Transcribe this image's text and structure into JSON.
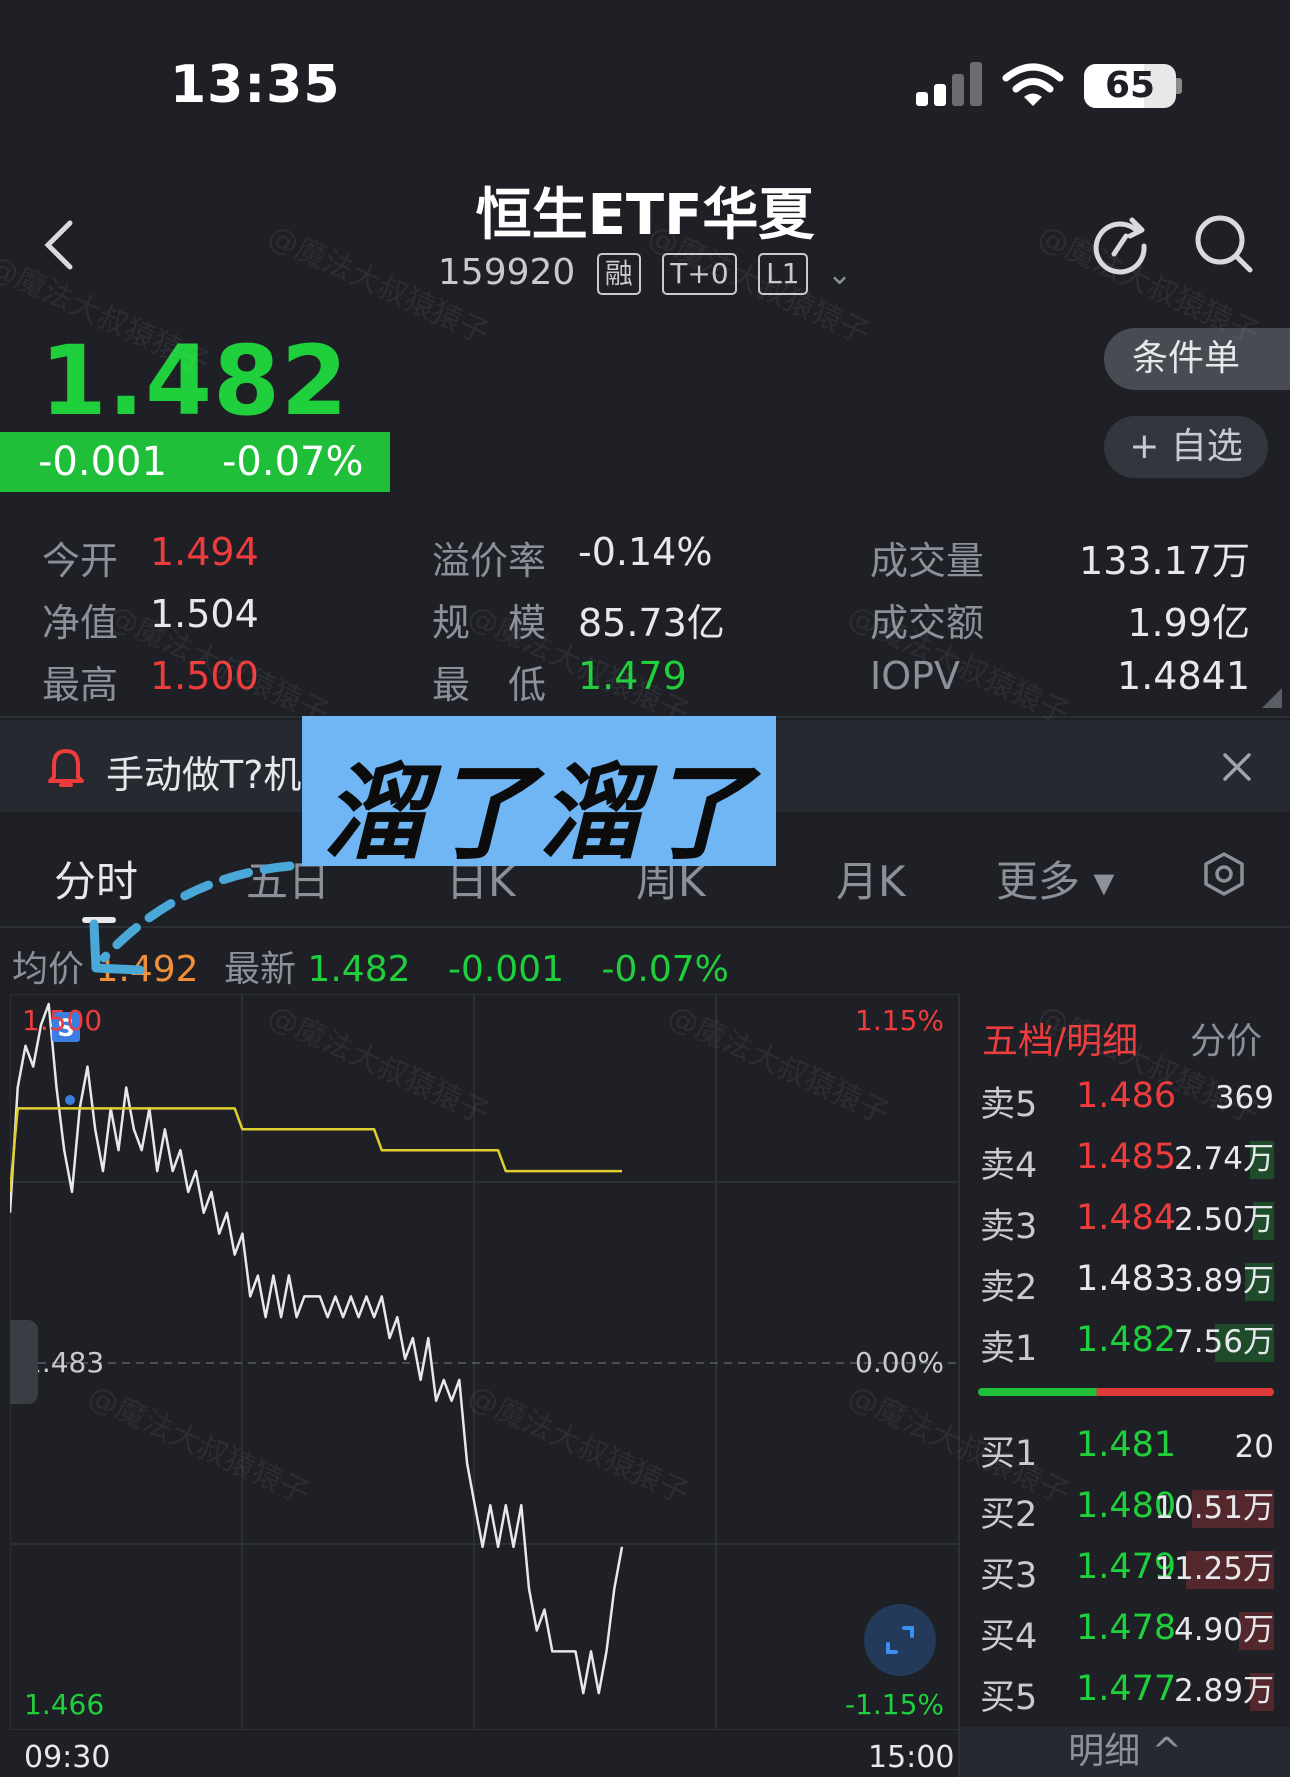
{
  "status_bar": {
    "time": "13:35",
    "battery": "65"
  },
  "header": {
    "title": "恒生ETF华夏",
    "code": "159920",
    "tags": [
      "融",
      "T+0",
      "L1"
    ]
  },
  "quote": {
    "price": "1.482",
    "change": "-0.001",
    "change_pct": "-0.07%",
    "buttons": {
      "condition_order": "条件单",
      "add_watch": "+ 自选"
    }
  },
  "stats": [
    {
      "label": "今开",
      "value": "1.494",
      "color": "red"
    },
    {
      "label": "溢价率",
      "value": "-0.14%",
      "color": "white"
    },
    {
      "label": "成交量",
      "value": "133.17万",
      "color": "white"
    },
    {
      "label": "净值",
      "value": "1.504",
      "color": "white"
    },
    {
      "label": "规　模",
      "value": "85.73亿",
      "color": "white"
    },
    {
      "label": "成交额",
      "value": "1.99亿",
      "color": "white"
    },
    {
      "label": "最高",
      "value": "1.500",
      "color": "red"
    },
    {
      "label": "最　低",
      "value": "1.479",
      "color": "green"
    },
    {
      "label": "IOPV",
      "value": "1.4841",
      "color": "white"
    }
  ],
  "notice": {
    "text": "手动做T?机"
  },
  "sticker": {
    "text": "溜了溜了"
  },
  "tabs": [
    "分时",
    "五日",
    "日K",
    "周K",
    "月K",
    "更多 ▾"
  ],
  "info_line": {
    "avg_label": "均价",
    "avg_value": "1.492",
    "latest_label": "最新",
    "latest_value": "1.482",
    "change": "-0.001",
    "change_pct": "-0.07%"
  },
  "chart_data": {
    "type": "line",
    "y_left_labels": {
      "top": "1.500",
      "mid": "1.483",
      "bottom": "1.466"
    },
    "y_right_labels": {
      "top": "1.15%",
      "mid": "0.00%",
      "bottom": "-1.15%"
    },
    "x_labels": {
      "start": "09:30",
      "end": "15:00"
    },
    "ylim": [
      1.466,
      1.5
    ],
    "marker": "S",
    "series": [
      {
        "kind": "price",
        "color": "#e6e8ec",
        "values": [
          1.49,
          1.496,
          1.498,
          1.497,
          1.499,
          1.5,
          1.496,
          1.493,
          1.491,
          1.495,
          1.497,
          1.494,
          1.492,
          1.495,
          1.493,
          1.496,
          1.494,
          1.493,
          1.495,
          1.492,
          1.494,
          1.492,
          1.493,
          1.491,
          1.492,
          1.49,
          1.491,
          1.489,
          1.49,
          1.488,
          1.489,
          1.486,
          1.487,
          1.485,
          1.487,
          1.485,
          1.487,
          1.485,
          1.486,
          1.486,
          1.486,
          1.485,
          1.486,
          1.485,
          1.486,
          1.485,
          1.486,
          1.485,
          1.486,
          1.484,
          1.485,
          1.483,
          1.484,
          1.482,
          1.484,
          1.481,
          1.482,
          1.481,
          1.482,
          1.478,
          1.476,
          1.474,
          1.476,
          1.474,
          1.476,
          1.474,
          1.476,
          1.472,
          1.47,
          1.471,
          1.469,
          1.469,
          1.469,
          1.469,
          1.467,
          1.469,
          1.467,
          1.469,
          1.472,
          1.474
        ]
      },
      {
        "kind": "average",
        "color": "#e0cf2e",
        "values": [
          1.491,
          1.495,
          1.495,
          1.495,
          1.495,
          1.495,
          1.495,
          1.495,
          1.495,
          1.495,
          1.495,
          1.495,
          1.495,
          1.495,
          1.495,
          1.495,
          1.495,
          1.495,
          1.495,
          1.495,
          1.495,
          1.495,
          1.495,
          1.495,
          1.495,
          1.495,
          1.495,
          1.495,
          1.495,
          1.495,
          1.494,
          1.494,
          1.494,
          1.494,
          1.494,
          1.494,
          1.494,
          1.494,
          1.494,
          1.494,
          1.494,
          1.494,
          1.494,
          1.494,
          1.494,
          1.494,
          1.494,
          1.494,
          1.493,
          1.493,
          1.493,
          1.493,
          1.493,
          1.493,
          1.493,
          1.493,
          1.493,
          1.493,
          1.493,
          1.493,
          1.493,
          1.493,
          1.493,
          1.493,
          1.492,
          1.492,
          1.492,
          1.492,
          1.492,
          1.492,
          1.492,
          1.492,
          1.492,
          1.492,
          1.492,
          1.492,
          1.492,
          1.492,
          1.492,
          1.492
        ]
      }
    ]
  },
  "order_book": {
    "title": "五档/明细",
    "mode": "分价",
    "asks": [
      {
        "label": "卖5",
        "price": "1.486",
        "volume": "369",
        "color": "red",
        "bar": 0
      },
      {
        "label": "卖4",
        "price": "1.485",
        "volume": "2.74万",
        "color": "red",
        "bar": 0.08
      },
      {
        "label": "卖3",
        "price": "1.484",
        "volume": "2.50万",
        "color": "red",
        "bar": 0.07
      },
      {
        "label": "卖2",
        "price": "1.483",
        "volume": "3.89万",
        "color": "white",
        "bar": 0.1
      },
      {
        "label": "卖1",
        "price": "1.482",
        "volume": "7.56万",
        "color": "green",
        "bar": 0.2
      }
    ],
    "bids": [
      {
        "label": "买1",
        "price": "1.481",
        "volume": "20",
        "color": "green",
        "bar": 0
      },
      {
        "label": "买2",
        "price": "1.480",
        "volume": "10.51万",
        "color": "green",
        "bar": 0.28
      },
      {
        "label": "买3",
        "price": "1.479",
        "volume": "11.25万",
        "color": "green",
        "bar": 0.3
      },
      {
        "label": "买4",
        "price": "1.478",
        "volume": "4.90万",
        "color": "green",
        "bar": 0.12
      },
      {
        "label": "买5",
        "price": "1.477",
        "volume": "2.89万",
        "color": "green",
        "bar": 0.08
      }
    ],
    "detail_label": "明细 ^"
  },
  "colors": {
    "up": "#ee3b3b",
    "down": "#1fcf3c",
    "avg": "#e0cf2e",
    "bg": "#1e2026"
  },
  "watermark": "@魔法大叔猿猿子"
}
